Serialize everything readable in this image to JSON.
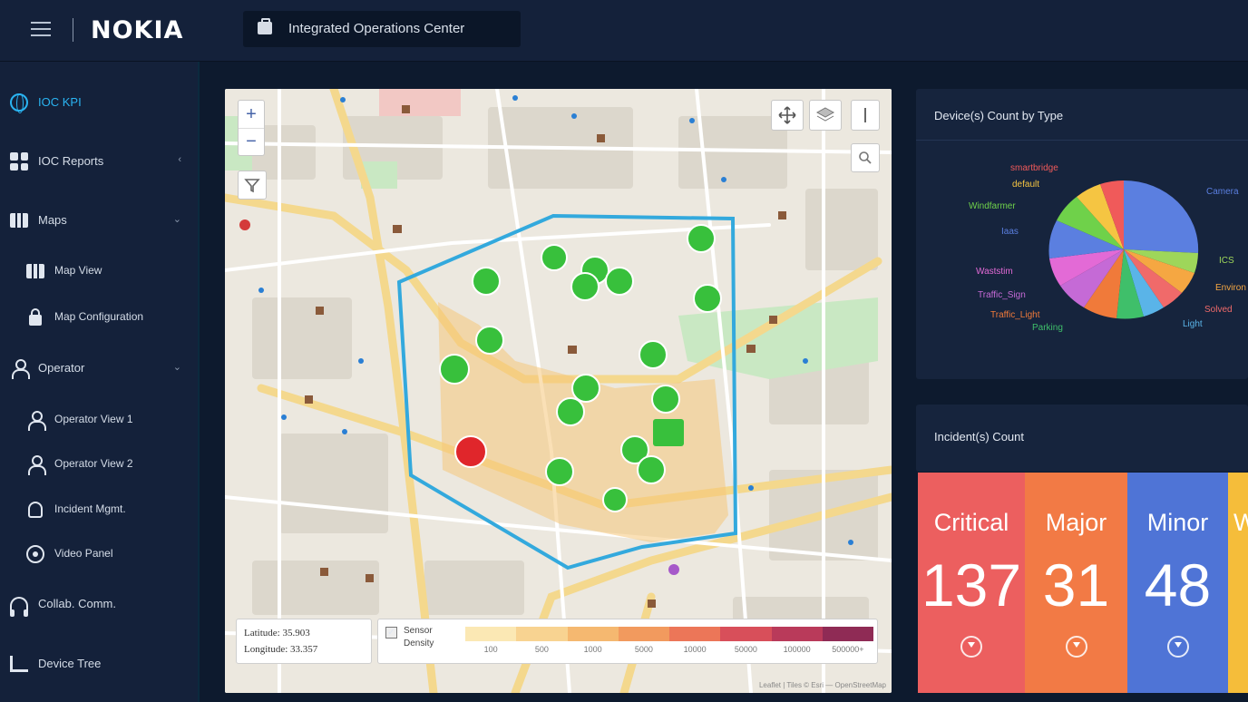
{
  "header": {
    "logo": "NOKIA",
    "app_title": "Integrated Operations Center"
  },
  "sidebar": {
    "items": [
      {
        "label": "IOC KPI",
        "icon": "globe-icon",
        "active": true
      },
      {
        "label": "IOC Reports",
        "icon": "grid-icon",
        "chevron": "‹"
      },
      {
        "label": "Maps",
        "icon": "map-icon",
        "chevron": "⌄"
      },
      {
        "label": "Map View",
        "icon": "map-icon"
      },
      {
        "label": "Map Configuration",
        "icon": "lock-icon"
      },
      {
        "label": "Operator",
        "icon": "person-icon",
        "chevron": "⌄"
      },
      {
        "label": "Operator View 1",
        "icon": "person-icon"
      },
      {
        "label": "Operator View 2",
        "icon": "person-icon"
      },
      {
        "label": "Incident Mgmt.",
        "icon": "bell-icon"
      },
      {
        "label": "Video Panel",
        "icon": "video-icon"
      },
      {
        "label": "Collab. Comm.",
        "icon": "headset-icon"
      },
      {
        "label": "Device Tree",
        "icon": "tree-icon"
      }
    ]
  },
  "map": {
    "zoom_in": "+",
    "zoom_out": "−",
    "latitude_label": "Latitude: 35.903",
    "longitude_label": "Longitude: 33.357",
    "legend_title_1": "Sensor",
    "legend_title_2": "Density",
    "legend_colors": [
      "#fbe8b4",
      "#f8d391",
      "#f5b870",
      "#f29a5e",
      "#ec7658",
      "#d84f5a",
      "#b93a5a",
      "#8f2b55"
    ],
    "legend_ticks": [
      "100",
      "500",
      "1000",
      "5000",
      "10000",
      "50000",
      "100000",
      "500000+"
    ],
    "attribution": "Leaflet | Tiles © Esri — OpenStreetMap"
  },
  "device_panel": {
    "title": "Device(s) Count by Type",
    "pie_labels": [
      {
        "text": "smartbridge",
        "color": "#f05a5a"
      },
      {
        "text": "default",
        "color": "#f5c542"
      },
      {
        "text": "Windfarmer",
        "color": "#6fd14a"
      },
      {
        "text": "Iaas",
        "color": "#5b7fe0"
      },
      {
        "text": "Waststim",
        "color": "#e36ad6"
      },
      {
        "text": "Traffic_Sign",
        "color": "#c56ad6"
      },
      {
        "text": "Traffic_Light",
        "color": "#f07a3a"
      },
      {
        "text": "Parking",
        "color": "#3fbf6a"
      },
      {
        "text": "Light",
        "color": "#5ab4e8"
      },
      {
        "text": "Solved",
        "color": "#f06a6a"
      },
      {
        "text": "Environ",
        "color": "#f5a742"
      },
      {
        "text": "ICS",
        "color": "#9ed65a"
      },
      {
        "text": "Camera",
        "color": "#5b7fe0"
      }
    ]
  },
  "incident_panel": {
    "title": "Incident(s) Count",
    "cards": [
      {
        "label": "Critical",
        "value": "137",
        "color": "#ec5f5f"
      },
      {
        "label": "Major",
        "value": "31",
        "color": "#f27a45"
      },
      {
        "label": "Minor",
        "value": "48",
        "color": "#4f74d6"
      },
      {
        "label": "W",
        "value": "",
        "color": "#f5bd3a"
      }
    ]
  }
}
